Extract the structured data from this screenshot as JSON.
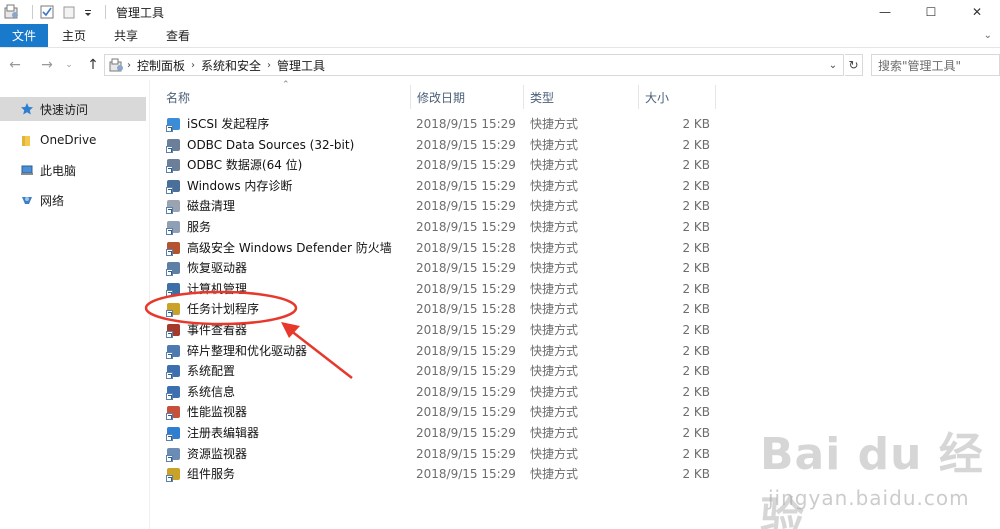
{
  "window": {
    "title": "管理工具",
    "controls": [
      "—",
      "☐",
      "✕"
    ]
  },
  "ribbon": {
    "tabs": [
      "文件",
      "主页",
      "共享",
      "查看"
    ]
  },
  "address": {
    "crumbs": [
      "控制面板",
      "系统和安全",
      "管理工具"
    ],
    "search_placeholder": "搜索\"管理工具\""
  },
  "sidebar": {
    "items": [
      {
        "label": "快速访问",
        "icon": "star-icon"
      },
      {
        "label": "OneDrive",
        "icon": "cloud-folder-icon"
      },
      {
        "label": "此电脑",
        "icon": "computer-icon"
      },
      {
        "label": "网络",
        "icon": "network-icon"
      }
    ]
  },
  "columns": {
    "name": "名称",
    "date": "修改日期",
    "type": "类型",
    "size": "大小"
  },
  "files": [
    {
      "name": "iSCSI 发起程序",
      "date": "2018/9/15 15:29",
      "type": "快捷方式",
      "size": "2 KB",
      "color": "#3a8dd8"
    },
    {
      "name": "ODBC Data Sources (32-bit)",
      "date": "2018/9/15 15:29",
      "type": "快捷方式",
      "size": "2 KB",
      "color": "#6b7f99"
    },
    {
      "name": "ODBC 数据源(64 位)",
      "date": "2018/9/15 15:29",
      "type": "快捷方式",
      "size": "2 KB",
      "color": "#6b7f99"
    },
    {
      "name": "Windows 内存诊断",
      "date": "2018/9/15 15:29",
      "type": "快捷方式",
      "size": "2 KB",
      "color": "#4a6f98"
    },
    {
      "name": "磁盘清理",
      "date": "2018/9/15 15:29",
      "type": "快捷方式",
      "size": "2 KB",
      "color": "#9aa4b0"
    },
    {
      "name": "服务",
      "date": "2018/9/15 15:29",
      "type": "快捷方式",
      "size": "2 KB",
      "color": "#8fa0b5"
    },
    {
      "name": "高级安全 Windows Defender 防火墙",
      "date": "2018/9/15 15:28",
      "type": "快捷方式",
      "size": "2 KB",
      "color": "#b5532f"
    },
    {
      "name": "恢复驱动器",
      "date": "2018/9/15 15:29",
      "type": "快捷方式",
      "size": "2 KB",
      "color": "#5d7fa6"
    },
    {
      "name": "计算机管理",
      "date": "2018/9/15 15:29",
      "type": "快捷方式",
      "size": "2 KB",
      "color": "#3c6ea8"
    },
    {
      "name": "任务计划程序",
      "date": "2018/9/15 15:28",
      "type": "快捷方式",
      "size": "2 KB",
      "color": "#c9a227"
    },
    {
      "name": "事件查看器",
      "date": "2018/9/15 15:29",
      "type": "快捷方式",
      "size": "2 KB",
      "color": "#a63a2a"
    },
    {
      "name": "碎片整理和优化驱动器",
      "date": "2018/9/15 15:29",
      "type": "快捷方式",
      "size": "2 KB",
      "color": "#4b79b0"
    },
    {
      "name": "系统配置",
      "date": "2018/9/15 15:29",
      "type": "快捷方式",
      "size": "2 KB",
      "color": "#3d6fb0"
    },
    {
      "name": "系统信息",
      "date": "2018/9/15 15:29",
      "type": "快捷方式",
      "size": "2 KB",
      "color": "#3d6fb0"
    },
    {
      "name": "性能监视器",
      "date": "2018/9/15 15:29",
      "type": "快捷方式",
      "size": "2 KB",
      "color": "#c84f3a"
    },
    {
      "name": "注册表编辑器",
      "date": "2018/9/15 15:29",
      "type": "快捷方式",
      "size": "2 KB",
      "color": "#2f7fd0"
    },
    {
      "name": "资源监视器",
      "date": "2018/9/15 15:29",
      "type": "快捷方式",
      "size": "2 KB",
      "color": "#6b8db5"
    },
    {
      "name": "组件服务",
      "date": "2018/9/15 15:29",
      "type": "快捷方式",
      "size": "2 KB",
      "color": "#c9a227"
    }
  ],
  "annotation": {
    "color": "#e8382c"
  },
  "watermark": {
    "logo": "Bai du 经验",
    "url": "jingyan.baidu.com"
  }
}
